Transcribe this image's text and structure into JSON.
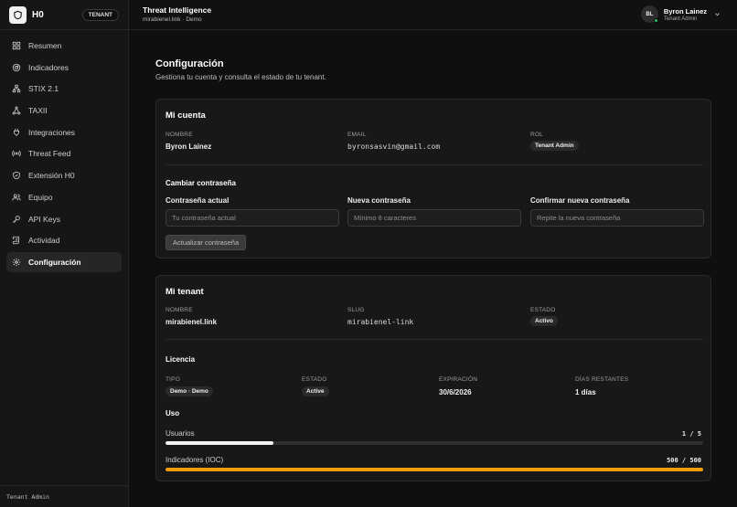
{
  "brand": {
    "name": "H0",
    "tenant_pill": "TENANT"
  },
  "nav": {
    "items": [
      {
        "label": "Resumen",
        "icon": "grid-icon"
      },
      {
        "label": "Indicadores",
        "icon": "radar-icon"
      },
      {
        "label": "STIX 2.1",
        "icon": "network-icon"
      },
      {
        "label": "TAXII",
        "icon": "share-icon"
      },
      {
        "label": "Integraciones",
        "icon": "plug-icon"
      },
      {
        "label": "Threat Feed",
        "icon": "broadcast-icon"
      },
      {
        "label": "Extensión H0",
        "icon": "shield-icon"
      },
      {
        "label": "Equipo",
        "icon": "users-icon"
      },
      {
        "label": "API Keys",
        "icon": "key-icon"
      },
      {
        "label": "Actividad",
        "icon": "scroll-icon"
      },
      {
        "label": "Configuración",
        "icon": "gear-icon",
        "active": true
      }
    ],
    "footer": "Tenant Admin"
  },
  "header": {
    "title": "Threat Intelligence",
    "subtitle": "mirabienel.link · Demo",
    "user_initials": "BL",
    "user_name": "Byron Lainez",
    "user_role": "Tenant Admin"
  },
  "page": {
    "title": "Configuración",
    "subtitle": "Gestiona tu cuenta y consulta el estado de tu tenant."
  },
  "account": {
    "title": "Mi cuenta",
    "name_label": "NOMBRE",
    "name": "Byron Lainez",
    "email_label": "EMAIL",
    "email": "byronsasvin@gmail.com",
    "role_label": "ROL",
    "role": "Tenant Admin",
    "password_section": "Cambiar contraseña",
    "current_label": "Contraseña actual",
    "current_placeholder": "Tu contraseña actual",
    "new_label": "Nueva contraseña",
    "new_placeholder": "Mínimo 8 caracteres",
    "confirm_label": "Confirmar nueva contraseña",
    "confirm_placeholder": "Repite la nueva contraseña",
    "update_button": "Actualizar contraseña"
  },
  "tenant": {
    "title": "Mi tenant",
    "name_label": "NOMBRE",
    "name": "mirabienel.link",
    "slug_label": "SLUG",
    "slug": "mirabienel-link",
    "status_label": "ESTADO",
    "status": "Activo",
    "license_section": "Licencia",
    "type_label": "TIPO",
    "type": "Demo · Demo",
    "lic_status_label": "ESTADO",
    "lic_status": "Active",
    "expiry_label": "EXPIRACIÓN",
    "expiry": "30/6/2026",
    "days_label": "DÍAS RESTANTES",
    "days": "1 días",
    "usage_section": "Uso",
    "users_label": "Usuarios",
    "users_value": "1 / 5",
    "users_fraction": 0.2,
    "users_color": "#f2f2f2",
    "ioc_label": "Indicadores (IOC)",
    "ioc_value": "500 / 500",
    "ioc_fraction": 1.0,
    "ioc_color": "#f59e0b"
  }
}
